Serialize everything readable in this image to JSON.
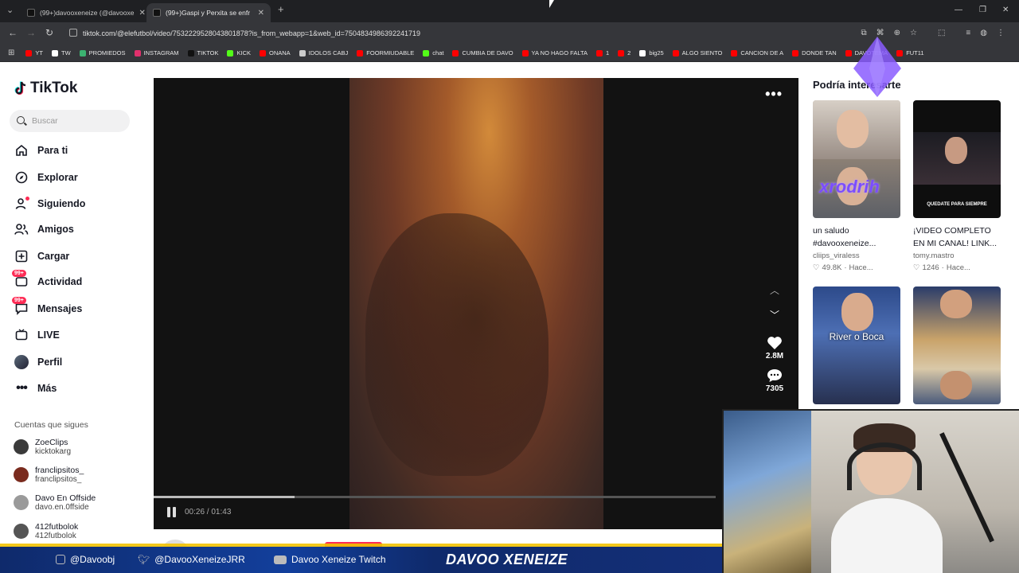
{
  "browser": {
    "tabs": [
      {
        "title": "(99+)davooxeneize (@davooxe",
        "active": false
      },
      {
        "title": "(99+)Gaspi y Perxita se enfr",
        "active": true
      }
    ],
    "url": "tiktok.com/@elefutbol/video/7532229528043801878?is_from_webapp=1&web_id=7504834986392241719",
    "bookmarks": [
      {
        "label": "YT",
        "color": "#ff0000"
      },
      {
        "label": "TW",
        "color": "#ffffff"
      },
      {
        "label": "PROMIEDOS",
        "color": "#3cb371"
      },
      {
        "label": "INSTAGRAM",
        "color": "#e1306c"
      },
      {
        "label": "TIKTOK",
        "color": "#111111"
      },
      {
        "label": "KICK",
        "color": "#53fc18"
      },
      {
        "label": "ONANA",
        "color": "#ff0000"
      },
      {
        "label": "IDOLOS CABJ",
        "color": "#cccccc"
      },
      {
        "label": "FOORMIUDABLE",
        "color": "#ff0000"
      },
      {
        "label": "chat",
        "color": "#53fc18"
      },
      {
        "label": "CUMBIA DE DAVO",
        "color": "#ff0000"
      },
      {
        "label": "YA NO HAGO FALTA",
        "color": "#ff0000"
      },
      {
        "label": "1",
        "color": "#ff0000"
      },
      {
        "label": "2",
        "color": "#ff0000"
      },
      {
        "label": "big25",
        "color": "#ffffff"
      },
      {
        "label": "ALGO SIENTO",
        "color": "#ff0000"
      },
      {
        "label": "CANCION DE A",
        "color": "#ff0000"
      },
      {
        "label": "DONDE TAN",
        "color": "#ff0000"
      },
      {
        "label": "DAVOTEMA",
        "color": "#ff0000"
      },
      {
        "label": "FUT11",
        "color": "#ff0000"
      }
    ]
  },
  "sidebar": {
    "logo": "TikTok",
    "search_placeholder": "Buscar",
    "items": [
      {
        "label": "Para ti",
        "icon": "home-icon"
      },
      {
        "label": "Explorar",
        "icon": "compass-icon"
      },
      {
        "label": "Siguiendo",
        "icon": "following-icon"
      },
      {
        "label": "Amigos",
        "icon": "friends-icon"
      },
      {
        "label": "Cargar",
        "icon": "upload-icon"
      },
      {
        "label": "Actividad",
        "icon": "activity-icon",
        "badge": "99+"
      },
      {
        "label": "Mensajes",
        "icon": "messages-icon",
        "badge": "99+"
      },
      {
        "label": "LIVE",
        "icon": "live-icon"
      },
      {
        "label": "Perfil",
        "icon": "profile-icon"
      },
      {
        "label": "Más",
        "icon": "more-icon"
      }
    ],
    "following_title": "Cuentas que sigues",
    "following": [
      {
        "name": "ZoeClips",
        "handle": "kicktokarg"
      },
      {
        "name": "franclipsitos_",
        "handle": "franclipsitos_"
      },
      {
        "name": "Davo En Offside",
        "handle": "davo.en.0ffside"
      },
      {
        "name": "412futbolok",
        "handle": "412futbolok"
      }
    ]
  },
  "player": {
    "time": "00:26 / 01:43",
    "progress": 0.25,
    "likes": "2.8M",
    "comments": "7305"
  },
  "recommendations": {
    "title": "Podría interesarte",
    "cards": [
      {
        "title": "un saludo #davooxeneize...",
        "user": "cliips_viraless",
        "stats": "49.8K",
        "time": "Hace...",
        "overlay": "xrodrih"
      },
      {
        "title": "¡VIDEO COMPLETO EN MI CANAL! LINK...",
        "user": "tomy.mastro",
        "stats": "1246",
        "time": "Hace...",
        "overlay": "QUEDATE PARA SIEMPRE"
      },
      {
        "title": "",
        "user": "",
        "stats": "",
        "time": "",
        "overlay": "River o Boca"
      },
      {
        "title": "",
        "user": "",
        "stats": "",
        "time": "",
        "overlay": ""
      }
    ]
  },
  "stream": {
    "instagram": "@Davoobj",
    "twitter": "@DavooXeneizeJRR",
    "youtube": "Davoo Xeneize Twitch",
    "logo": "DAVOO XENEIZE"
  }
}
